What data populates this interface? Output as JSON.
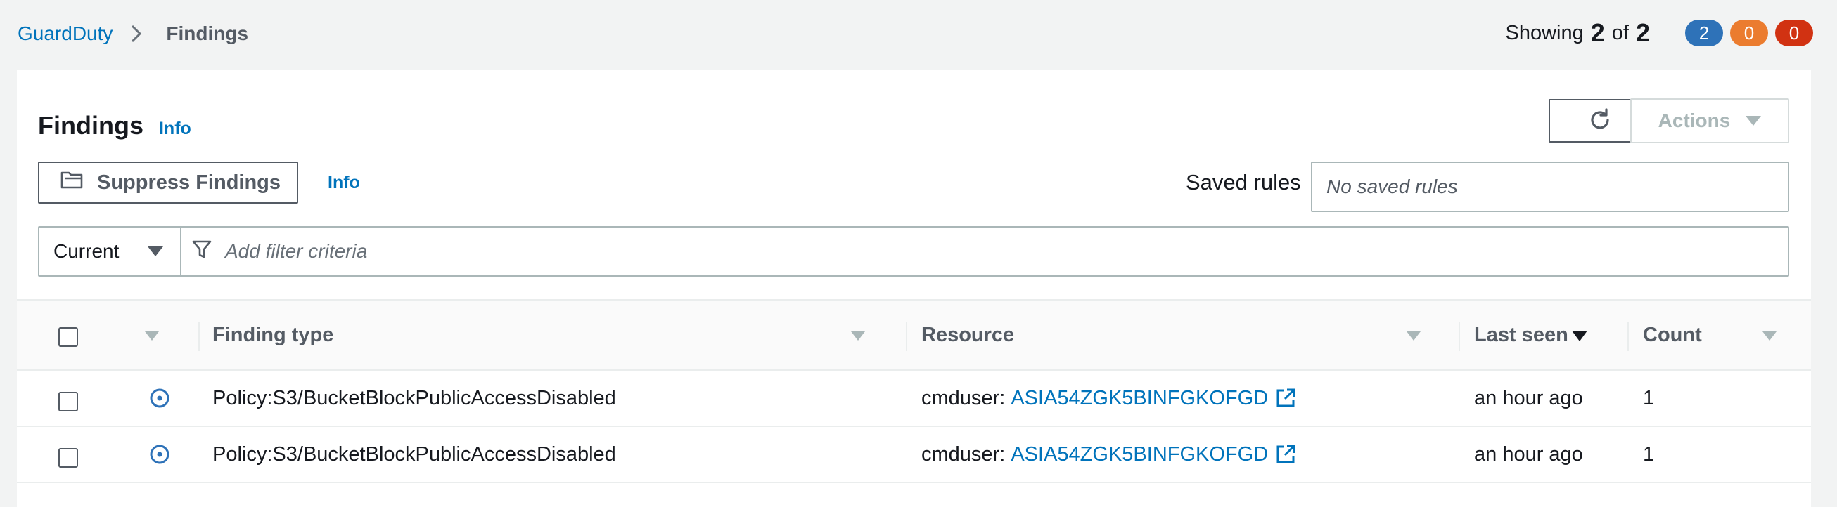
{
  "breadcrumb": {
    "root": "GuardDuty",
    "current": "Findings"
  },
  "summary": {
    "showing_label": "Showing",
    "shown": "2",
    "of_label": "of",
    "total": "2",
    "counters": [
      {
        "value": "2",
        "color": "#2e72b8"
      },
      {
        "value": "0",
        "color": "#eb7c2f"
      },
      {
        "value": "0",
        "color": "#d13212"
      }
    ]
  },
  "panel": {
    "title": "Findings",
    "title_info": "Info",
    "actions_label": "Actions",
    "suppress_label": "Suppress Findings",
    "suppress_info": "Info",
    "saved_rules_label": "Saved rules",
    "saved_rules_placeholder": "No saved rules",
    "filter_select": "Current",
    "filter_placeholder": "Add filter criteria"
  },
  "table": {
    "columns": {
      "finding_type": "Finding type",
      "resource": "Resource",
      "last_seen": "Last seen",
      "count": "Count"
    },
    "rows": [
      {
        "finding_type": "Policy:S3/BucketBlockPublicAccessDisabled",
        "resource_prefix": "cmduser:",
        "resource_link": "ASIA54ZGK5BINFGKOFGD",
        "last_seen": "an hour ago",
        "count": "1"
      },
      {
        "finding_type": "Policy:S3/BucketBlockPublicAccessDisabled",
        "resource_prefix": "cmduser:",
        "resource_link": "ASIA54ZGK5BINFGKOFGD",
        "last_seen": "an hour ago",
        "count": "1"
      }
    ]
  },
  "colors": {
    "accent_link": "#0073bb",
    "severity_low": "#2e72b8"
  }
}
